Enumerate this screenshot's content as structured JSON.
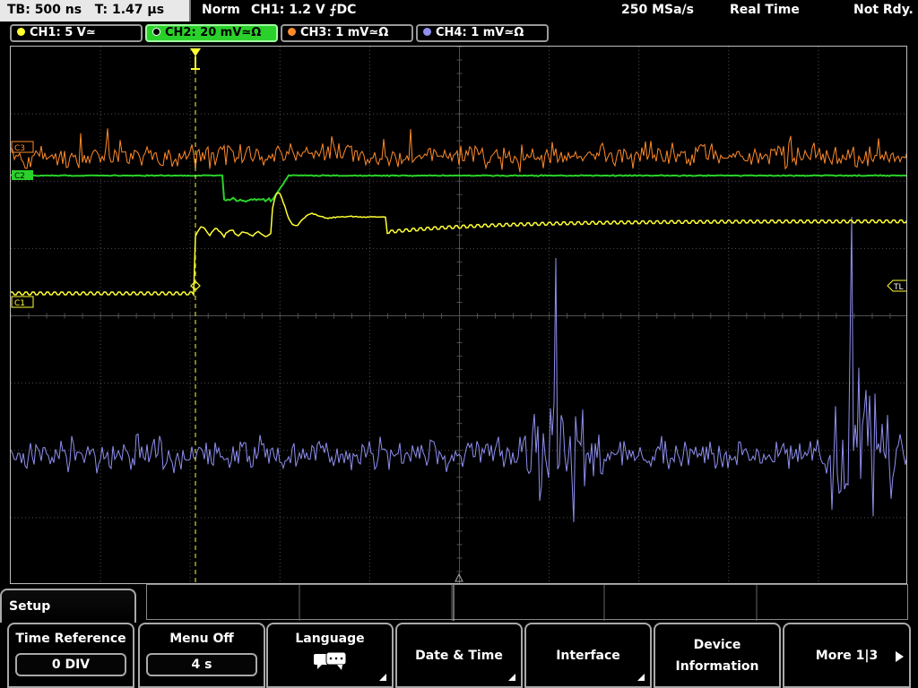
{
  "top_bar": {
    "timebase": "TB: 500 ns",
    "trigger_time": "T: 1.47 µs",
    "mode": "Norm",
    "trigger_setting": "CH1: 1.2 V ⨍DC",
    "sample_rate": "250 MSa/s",
    "acq_mode": "Real Time",
    "status": "Not Rdy."
  },
  "channels": [
    {
      "label": "CH1: 5 V≃",
      "color": "#ffff33",
      "active": false
    },
    {
      "label": "CH2: 20 mV≃Ω",
      "color": "#2bd12b",
      "active": true
    },
    {
      "label": "CH3: 1 mV≃Ω",
      "color": "#ff8a2a",
      "active": false
    },
    {
      "label": "CH4: 1 mV≃Ω",
      "color": "#8f8ff0",
      "active": false
    }
  ],
  "markers": {
    "ch3": "C3",
    "ch2": "C2",
    "ch1": "C1",
    "trigger_level": "TL"
  },
  "colors": {
    "ch1": "#ffff33",
    "ch2": "#2bd12b",
    "ch3": "#ff8a2a",
    "ch4": "#8f8ff0",
    "grid": "#505050"
  },
  "menu": {
    "title": "Setup",
    "soft_keys": [
      {
        "label": "Time Reference",
        "value": "0 DIV"
      },
      {
        "label": "Menu Off",
        "value": "4 s"
      },
      {
        "label": "Language",
        "icon": "speech-bubble-icon"
      },
      {
        "label": "Date & Time"
      },
      {
        "label": "Interface"
      },
      {
        "label": "Device Information"
      },
      {
        "label": "More 1|3"
      }
    ]
  }
}
